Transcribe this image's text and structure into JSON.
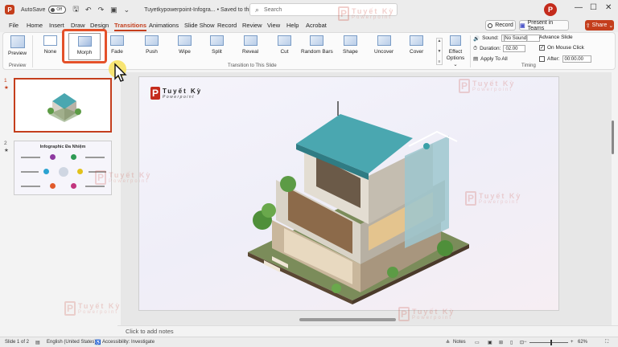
{
  "titlebar": {
    "app_icon_letter": "P",
    "autosave_label": "AutoSave",
    "autosave_state": "Off",
    "doc_title": "Tuyetkypowerpoint-Infogra... • Saved to this PC ⌄",
    "search_placeholder": "Search",
    "avatar_letter": "P"
  },
  "menu": {
    "items": [
      "File",
      "Home",
      "Insert",
      "Draw",
      "Design",
      "Transitions",
      "Animations",
      "Slide Show",
      "Record",
      "Review",
      "View",
      "Help",
      "Acrobat"
    ],
    "active": "Transitions",
    "record_label": "Record",
    "teams_label": "Present in Teams",
    "share_label": "Share"
  },
  "ribbon": {
    "preview_label": "Preview",
    "preview_group": "Preview",
    "transitions": [
      "None",
      "Morph",
      "Fade",
      "Push",
      "Wipe",
      "Split",
      "Reveal",
      "Cut",
      "Random Bars",
      "Shape",
      "Uncover",
      "Cover"
    ],
    "selected_transition": "Morph",
    "effect_options_label": "Effect Options ⌄",
    "transition_group": "Transition to This Slide",
    "sound_label": "Sound:",
    "sound_value": "[No Sound]",
    "duration_label": "Duration:",
    "duration_value": "02.00",
    "apply_all_label": "Apply To All",
    "advance_label": "Advance Slide",
    "on_mouse_click_label": "On Mouse Click",
    "on_mouse_click_checked": true,
    "after_label": "After:",
    "after_value": "00:00.00",
    "timing_group": "Timing"
  },
  "thumbnails": [
    {
      "number": "1",
      "marker": "★"
    },
    {
      "number": "2",
      "marker": "★",
      "title": "Infographic Đa Nhiệm"
    }
  ],
  "slide": {
    "logo_letter": "P",
    "logo_line1": "Tuyết Kỳ",
    "logo_line2": "Powerpoint"
  },
  "watermark": {
    "letter": "P",
    "line1": "Tuyết Kỳ",
    "line2": "Powerpoint"
  },
  "notes_placeholder": "Click to add notes",
  "status": {
    "slide_counter": "Slide 1 of 2",
    "language": "English (United States)",
    "accessibility": "Accessibility: Investigate",
    "notes_label": "Notes",
    "zoom": "62%"
  },
  "colors": {
    "accent": "#c43e1c",
    "highlight": "#e4512a",
    "cursor_halo": "#f7e15a"
  }
}
